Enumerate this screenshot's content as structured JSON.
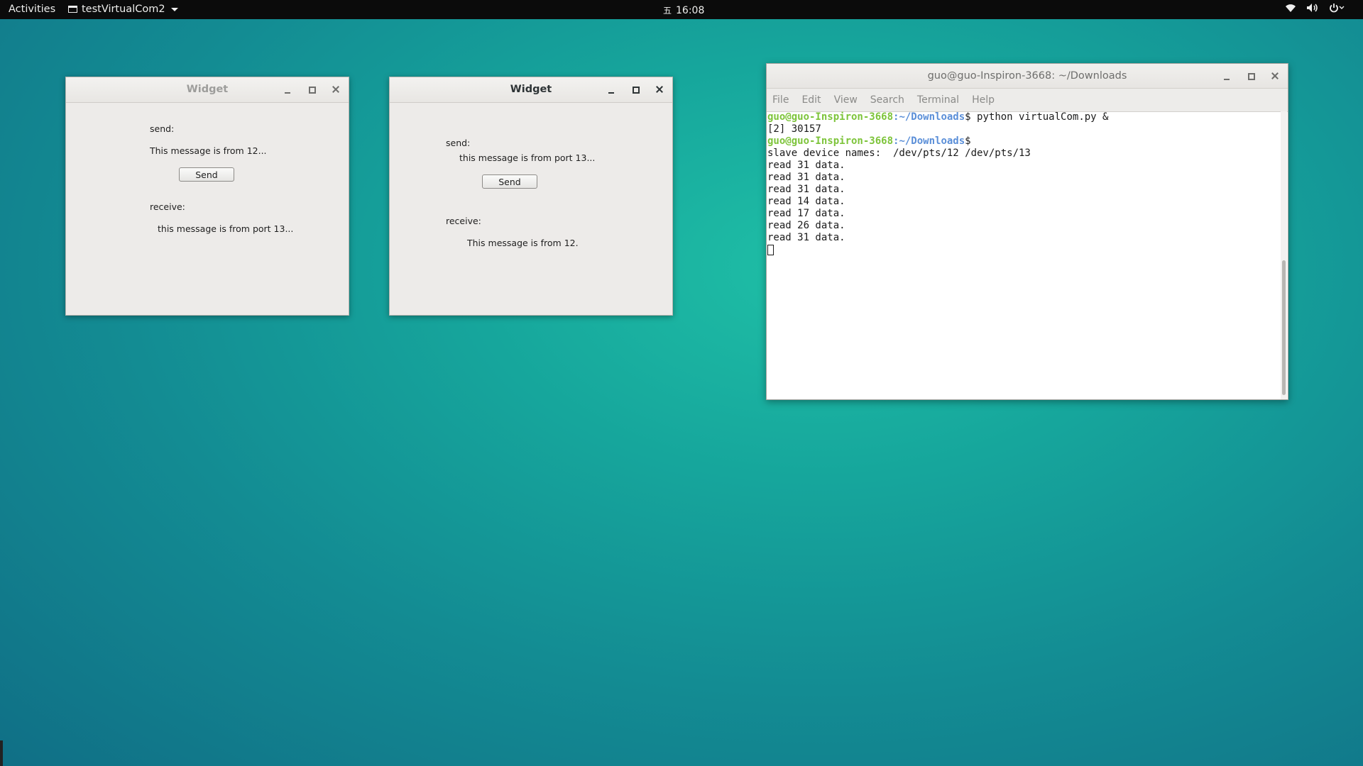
{
  "topbar": {
    "activities": "Activities",
    "app_name": "testVirtualCom2",
    "clock_glyph": "五",
    "time": "16:08",
    "status_icons": [
      "wifi-icon",
      "volume-icon",
      "power-icon"
    ]
  },
  "widget_left": {
    "title": "Widget",
    "send_label": "send:",
    "send_text": "This message is from 12...",
    "send_button": "Send",
    "receive_label": "receive:",
    "receive_text": "this message is from port 13..."
  },
  "widget_right": {
    "title": "Widget",
    "send_label": "send:",
    "send_text": "this message is from port 13...",
    "send_button": "Send",
    "receive_label": "receive:",
    "receive_text": "This message is from 12."
  },
  "terminal": {
    "title": "guo@guo-Inspiron-3668: ~/Downloads",
    "menu": [
      "File",
      "Edit",
      "View",
      "Search",
      "Terminal",
      "Help"
    ],
    "prompt_user": "guo@guo-Inspiron-3668",
    "prompt_path": ":~/Downloads",
    "command": "$ python virtualCom.py &",
    "line_job": "[2] 30157",
    "prompt2_tail": "$",
    "line_slave": "slave device names:  /dev/pts/12 /dev/pts/13",
    "reads": [
      "read 31 data.",
      "read 31 data.",
      "read 31 data.",
      "read 14 data.",
      "read 17 data.",
      "read 26 data.",
      "read 31 data."
    ]
  },
  "colors": {
    "desktop_bg": "#16a69c",
    "prompt_user": "#7dc43a",
    "prompt_path": "#5b8fd8",
    "topbar": "#0b0b0b"
  }
}
